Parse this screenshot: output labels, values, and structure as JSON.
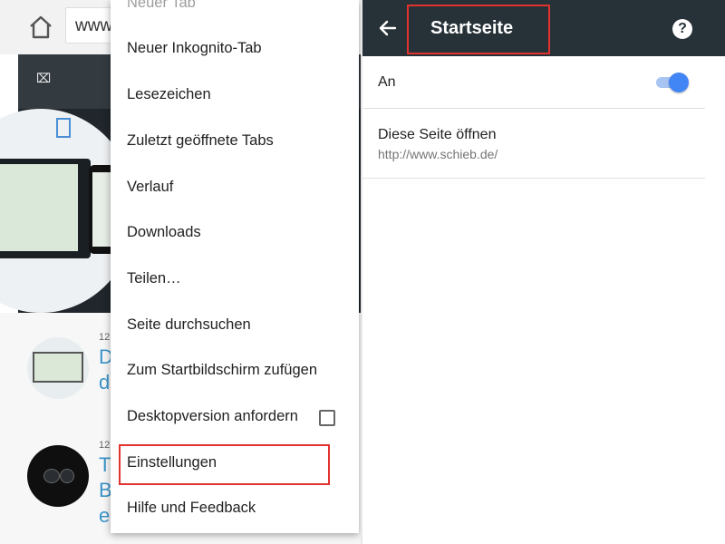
{
  "browser": {
    "url_text": "www.",
    "articles": [
      {
        "date": "12",
        "title_fragment": "D\nde"
      },
      {
        "date": "12",
        "title_fragment": "Ti\nBi\nei"
      }
    ]
  },
  "menu": {
    "items": [
      {
        "label": "Neuer Tab"
      },
      {
        "label": "Neuer Inkognito-Tab"
      },
      {
        "label": "Lesezeichen"
      },
      {
        "label": "Zuletzt geöffnete Tabs"
      },
      {
        "label": "Verlauf"
      },
      {
        "label": "Downloads"
      },
      {
        "label": "Teilen…"
      },
      {
        "label": "Seite durchsuchen"
      },
      {
        "label": "Zum Startbildschirm zufügen"
      },
      {
        "label": "Desktopversion anfordern"
      },
      {
        "label": "Einstellungen"
      },
      {
        "label": "Hilfe und Feedback"
      }
    ],
    "desktop_checked": false
  },
  "settings": {
    "title": "Startseite",
    "toggle_label": "An",
    "toggle_on": true,
    "open_page_label": "Diese Seite öffnen",
    "open_page_url": "http://www.schieb.de/",
    "help_glyph": "?"
  },
  "colors": {
    "accent": "#4285f4",
    "highlight": "#e0322e",
    "app_bar": "#263238",
    "link": "#3a94c9"
  }
}
